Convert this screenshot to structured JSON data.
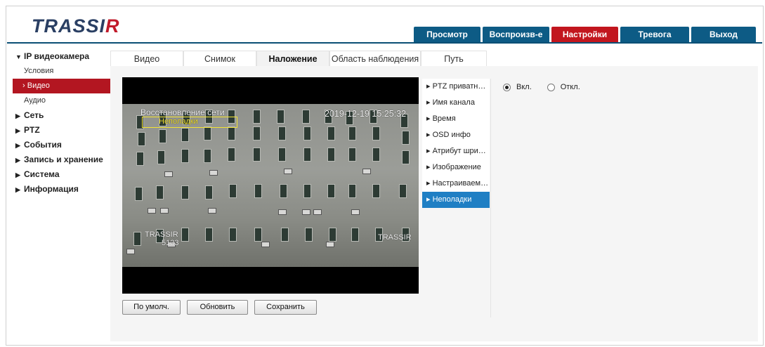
{
  "brand": {
    "logo_main": "TRASSI",
    "logo_r": "R"
  },
  "topnav": [
    {
      "label": "Просмотр",
      "active": false
    },
    {
      "label": "Воспроизв-е",
      "active": false
    },
    {
      "label": "Настройки",
      "active": true
    },
    {
      "label": "Тревога",
      "active": false
    },
    {
      "label": "Выход",
      "active": false
    }
  ],
  "sidebar": {
    "camera_group": "IP видеокамера",
    "sub_conditions": "Условия",
    "sub_video": "Видео",
    "sub_audio": "Аудио",
    "network": "Сеть",
    "ptz": "PTZ",
    "events": "События",
    "recording": "Запись и хранение",
    "system": "Система",
    "info": "Информация"
  },
  "subtabs": [
    "Видео",
    "Снимок",
    "Наложение",
    "Область наблюдения",
    "Путь"
  ],
  "video_overlay": {
    "recovery_text": "Восстановление сети",
    "trouble_text": "Неполадки",
    "datetime": "2019-12-19 15:25:32",
    "watermark_left": "TRASSIR",
    "watermark_left_sub": "5123",
    "watermark_right": "TRASSIR"
  },
  "buttons": {
    "default": "По умолч.",
    "refresh": "Обновить",
    "save": "Сохранить"
  },
  "osd_menu": [
    {
      "label": "PTZ приватн…",
      "active": false
    },
    {
      "label": "Имя канала",
      "active": false
    },
    {
      "label": "Время",
      "active": false
    },
    {
      "label": "OSD инфо",
      "active": false
    },
    {
      "label": "Атрибут шри…",
      "active": false
    },
    {
      "label": "Изображение",
      "active": false
    },
    {
      "label": "Настраиваем…",
      "active": false
    },
    {
      "label": "Неполадки",
      "active": true
    }
  ],
  "options": {
    "on_label": "Вкл.",
    "off_label": "Откл.",
    "selected": "Вкл."
  }
}
